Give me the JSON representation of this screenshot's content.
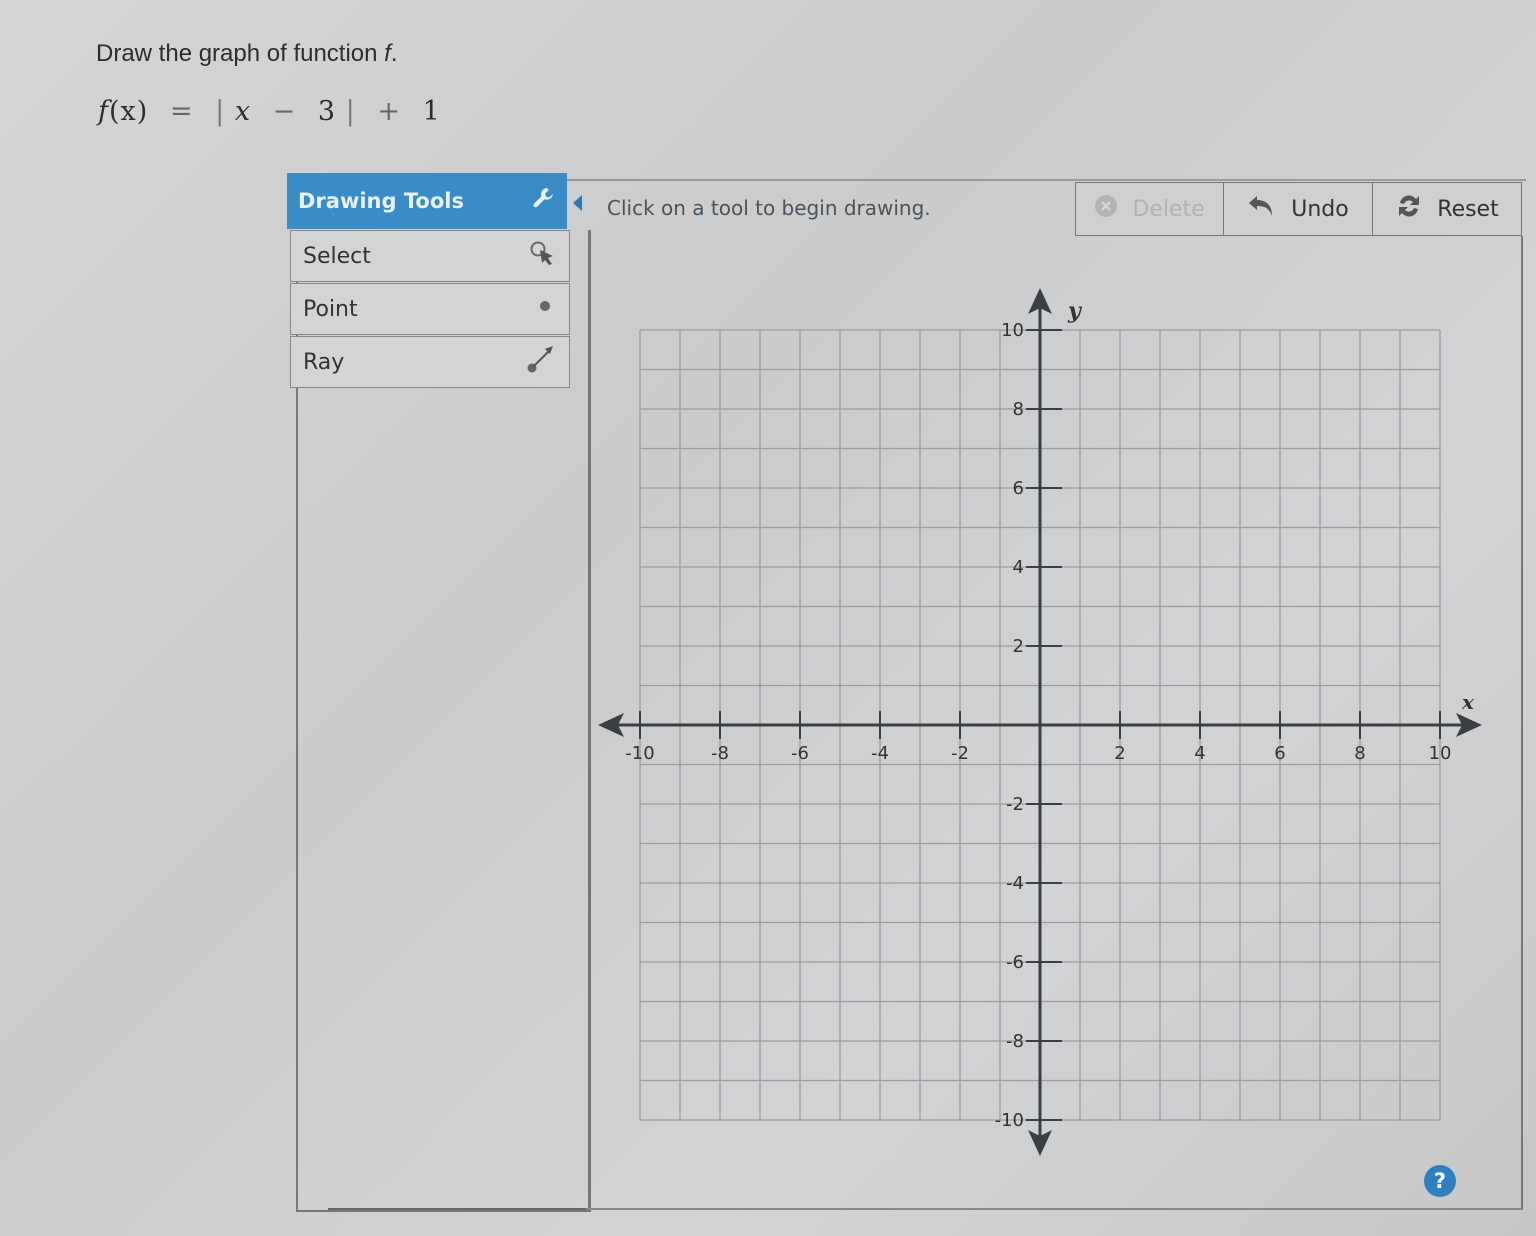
{
  "question": {
    "prompt_prefix": "Draw the graph of function ",
    "prompt_var": "f",
    "prompt_suffix": ".",
    "formula": {
      "lhs_fn": "f",
      "lhs_arg": "(x)",
      "equals": "=",
      "abs_open": "|",
      "var": "x",
      "minus": "−",
      "shift": "3",
      "abs_close": "|",
      "plus": "+",
      "offset": "1"
    }
  },
  "tools": {
    "header": "Drawing Tools",
    "header_icon": "wrench-icon",
    "items": [
      {
        "label": "Select",
        "icon": "select-cursor-icon"
      },
      {
        "label": "Point",
        "icon": "point-dot-icon"
      },
      {
        "label": "Ray",
        "icon": "ray-icon"
      }
    ]
  },
  "status": {
    "message": "Click on a tool to begin drawing."
  },
  "toolbar": {
    "delete_label": "Delete",
    "delete_enabled": false,
    "undo_label": "Undo",
    "reset_label": "Reset"
  },
  "colors": {
    "accent": "#3a8cc7",
    "help": "#2f7fbf",
    "axis": "#3b3f43",
    "grid": "#9a9c9e"
  },
  "help_label": "?",
  "chart_data": {
    "type": "scatter",
    "title": "",
    "xlabel": "x",
    "ylabel": "y",
    "xlim": [
      -10,
      10
    ],
    "ylim": [
      -10,
      10
    ],
    "grid": true,
    "grid_step": 1,
    "x_ticks": [
      -10,
      -8,
      -6,
      -4,
      -2,
      2,
      4,
      6,
      8,
      10
    ],
    "y_ticks": [
      10,
      8,
      6,
      4,
      2,
      -2,
      -4,
      -6,
      -8,
      -10
    ],
    "x_tick_labels": [
      "-10",
      "-8",
      "-6",
      "-4",
      "-2",
      "2",
      "4",
      "6",
      "8",
      "10"
    ],
    "y_tick_labels": [
      "10",
      "8",
      "6",
      "4",
      "2",
      "-2",
      "-4",
      "-6",
      "-8",
      "-10"
    ],
    "series": []
  }
}
